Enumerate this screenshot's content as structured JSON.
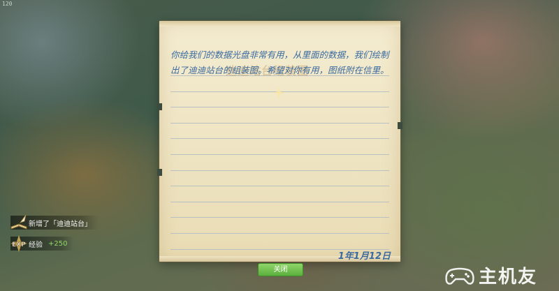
{
  "hud": {
    "fps": "120"
  },
  "letter": {
    "title_watermark": "迪迪站台组装图",
    "message_line1": "你给我们的数据光盘非常有用，从里面的数据，我们绘制",
    "message_line2": "出了迪迪站台的组装图。希望对你有用，图纸附在信里。",
    "date": "1年1月12日",
    "close_label": "关闭"
  },
  "notifications": [
    {
      "text": "新增了「迪迪站台」",
      "icon": "book-quill-icon"
    },
    {
      "text": "经验",
      "value": "+250",
      "icon": "exp-icon"
    }
  ],
  "watermark": {
    "text": "主机友",
    "icon": "gamepad-icon"
  },
  "colors": {
    "ink": "#3a6aa0",
    "paper": "#efe5c4",
    "button_green": "#5bb03c",
    "exp_green": "#8fd96a"
  }
}
